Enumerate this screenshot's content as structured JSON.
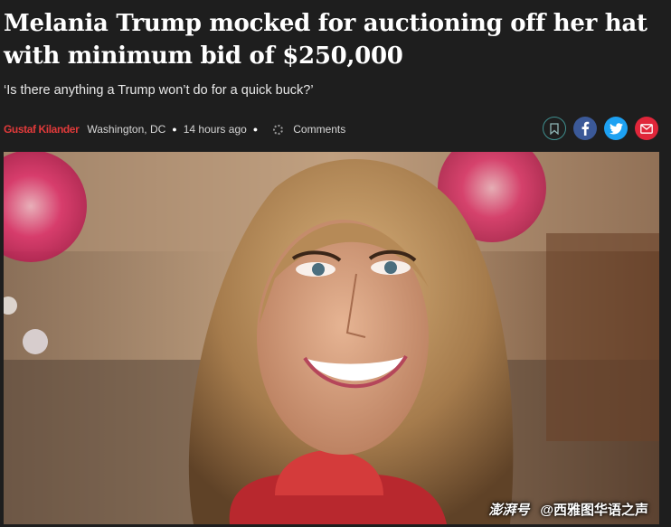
{
  "article": {
    "headline": "Melania Trump mocked for auctioning off her hat with minimum bid of $250,000",
    "standfirst": "‘Is there anything a Trump won’t do for a quick buck?’",
    "byline": {
      "author": "Gustaf Kilander",
      "location": "Washington, DC",
      "time": "14 hours ago",
      "comments_label": "Comments"
    }
  },
  "share": {
    "icons": [
      "bookmark-icon",
      "facebook-icon",
      "twitter-icon",
      "email-icon"
    ],
    "colors": {
      "facebook": "#3b5998",
      "twitter": "#1da1f2",
      "email": "#e0263a",
      "bookmark_border": "#3f8f8f"
    }
  },
  "image": {
    "side_credit": "",
    "caption": "",
    "watermark_logo": "澎湃号",
    "watermark_text": "@西雅图华语之声"
  },
  "colors": {
    "background": "#1e1e1e",
    "author": "#e03a3a"
  }
}
